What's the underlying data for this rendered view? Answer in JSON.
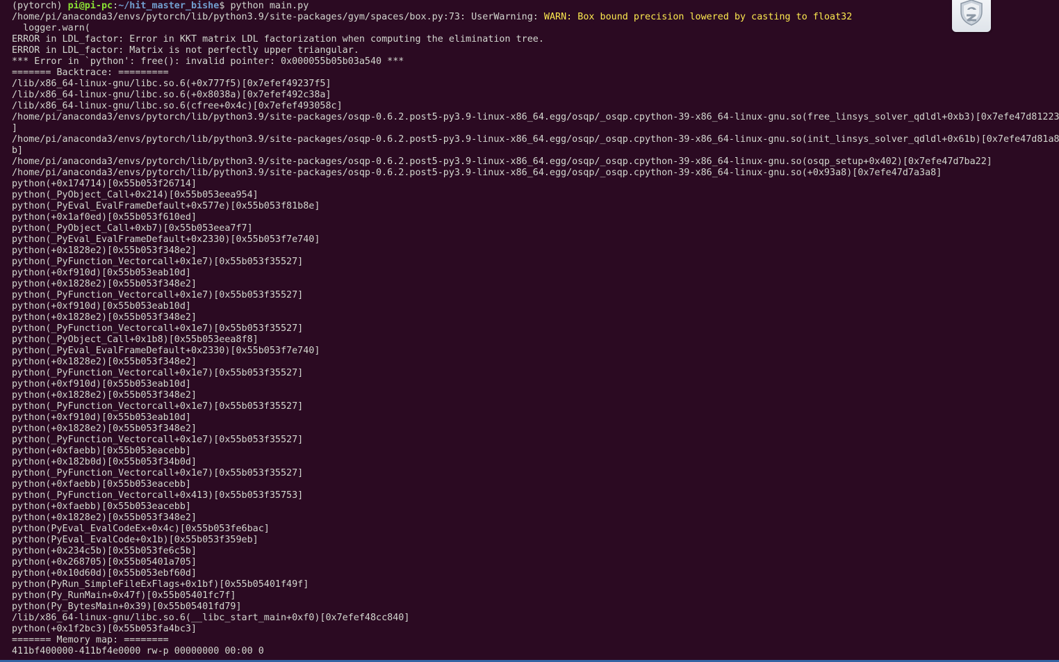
{
  "prompt": {
    "env": "(pytorch) ",
    "user_host": "pi@pi-pc",
    "colon": ":",
    "path": "~/hit_master_bishe",
    "dollar": "$ ",
    "command": "python main.py"
  },
  "warning": {
    "prefix": "/home/pi/anaconda3/envs/pytorch/lib/python3.9/site-packages/gym/spaces/box.py:73: UserWarning: ",
    "message": "WARN: Box bound precision lowered by casting to float32"
  },
  "lines": [
    "  logger.warn(",
    "ERROR in LDL_factor: Error in KKT matrix LDL factorization when computing the elimination tree.",
    "ERROR in LDL_factor: Matrix is not perfectly upper triangular.",
    "*** Error in `python': free(): invalid pointer: 0x000055b05b03a540 ***",
    "======= Backtrace: =========",
    "/lib/x86_64-linux-gnu/libc.so.6(+0x777f5)[0x7efef49237f5]",
    "/lib/x86_64-linux-gnu/libc.so.6(+0x8038a)[0x7efef492c38a]",
    "/lib/x86_64-linux-gnu/libc.so.6(cfree+0x4c)[0x7efef493058c]",
    "/home/pi/anaconda3/envs/pytorch/lib/python3.9/site-packages/osqp-0.6.2.post5-py3.9-linux-x86_64.egg/osqp/_osqp.cpython-39-x86_64-linux-gnu.so(free_linsys_solver_qdldl+0xb3)[0x7efe47d81223",
    "]",
    "/home/pi/anaconda3/envs/pytorch/lib/python3.9/site-packages/osqp-0.6.2.post5-py3.9-linux-x86_64.egg/osqp/_osqp.cpython-39-x86_64-linux-gnu.so(init_linsys_solver_qdldl+0x61b)[0x7efe47d81a8",
    "b]",
    "/home/pi/anaconda3/envs/pytorch/lib/python3.9/site-packages/osqp-0.6.2.post5-py3.9-linux-x86_64.egg/osqp/_osqp.cpython-39-x86_64-linux-gnu.so(osqp_setup+0x402)[0x7efe47d7ba22]",
    "/home/pi/anaconda3/envs/pytorch/lib/python3.9/site-packages/osqp-0.6.2.post5-py3.9-linux-x86_64.egg/osqp/_osqp.cpython-39-x86_64-linux-gnu.so(+0x93a8)[0x7efe47d7a3a8]",
    "python(+0x174714)[0x55b053f26714]",
    "python(_PyObject_Call+0x214)[0x55b053eea954]",
    "python(_PyEval_EvalFrameDefault+0x577e)[0x55b053f81b8e]",
    "python(+0x1af0ed)[0x55b053f610ed]",
    "python(_PyObject_Call+0xb7)[0x55b053eea7f7]",
    "python(_PyEval_EvalFrameDefault+0x2330)[0x55b053f7e740]",
    "python(+0x1828e2)[0x55b053f348e2]",
    "python(_PyFunction_Vectorcall+0x1e7)[0x55b053f35527]",
    "python(+0xf910d)[0x55b053eab10d]",
    "python(+0x1828e2)[0x55b053f348e2]",
    "python(_PyFunction_Vectorcall+0x1e7)[0x55b053f35527]",
    "python(+0xf910d)[0x55b053eab10d]",
    "python(+0x1828e2)[0x55b053f348e2]",
    "python(_PyFunction_Vectorcall+0x1e7)[0x55b053f35527]",
    "python(_PyObject_Call+0x1b8)[0x55b053eea8f8]",
    "python(_PyEval_EvalFrameDefault+0x2330)[0x55b053f7e740]",
    "python(+0x1828e2)[0x55b053f348e2]",
    "python(_PyFunction_Vectorcall+0x1e7)[0x55b053f35527]",
    "python(+0xf910d)[0x55b053eab10d]",
    "python(+0x1828e2)[0x55b053f348e2]",
    "python(_PyFunction_Vectorcall+0x1e7)[0x55b053f35527]",
    "python(+0xf910d)[0x55b053eab10d]",
    "python(+0x1828e2)[0x55b053f348e2]",
    "python(_PyFunction_Vectorcall+0x1e7)[0x55b053f35527]",
    "python(+0xfaebb)[0x55b053eacebb]",
    "python(+0x182b0d)[0x55b053f34b0d]",
    "python(_PyFunction_Vectorcall+0x1e7)[0x55b053f35527]",
    "python(+0xfaebb)[0x55b053eacebb]",
    "python(_PyFunction_Vectorcall+0x413)[0x55b053f35753]",
    "python(+0xfaebb)[0x55b053eacebb]",
    "python(+0x1828e2)[0x55b053f348e2]",
    "python(PyEval_EvalCodeEx+0x4c)[0x55b053fe6bac]",
    "python(PyEval_EvalCode+0x1b)[0x55b053f359eb]",
    "python(+0x234c5b)[0x55b053fe6c5b]",
    "python(+0x268705)[0x55b05401a705]",
    "python(+0x10d60d)[0x55b053ebf60d]",
    "python(PyRun_SimpleFileExFlags+0x1bf)[0x55b05401f49f]",
    "python(Py_RunMain+0x47f)[0x55b05401fc7f]",
    "python(Py_BytesMain+0x39)[0x55b05401fd79]",
    "/lib/x86_64-linux-gnu/libc.so.6(__libc_start_main+0xf0)[0x7efef48cc840]",
    "python(+0x1f2bc3)[0x55b053fa4bc3]",
    "======= Memory map: ========",
    "411bf400000-411bf4e0000 rw-p 00000000 00:00 0"
  ],
  "badge": {
    "icon": "shield-icon"
  },
  "colors": {
    "background": "#2b0a22",
    "text": "#d3d7cf",
    "prompt_user": "#8ae234",
    "prompt_path": "#729fcf",
    "warning": "#fce94f",
    "bottom_bar": "#3465a4"
  }
}
